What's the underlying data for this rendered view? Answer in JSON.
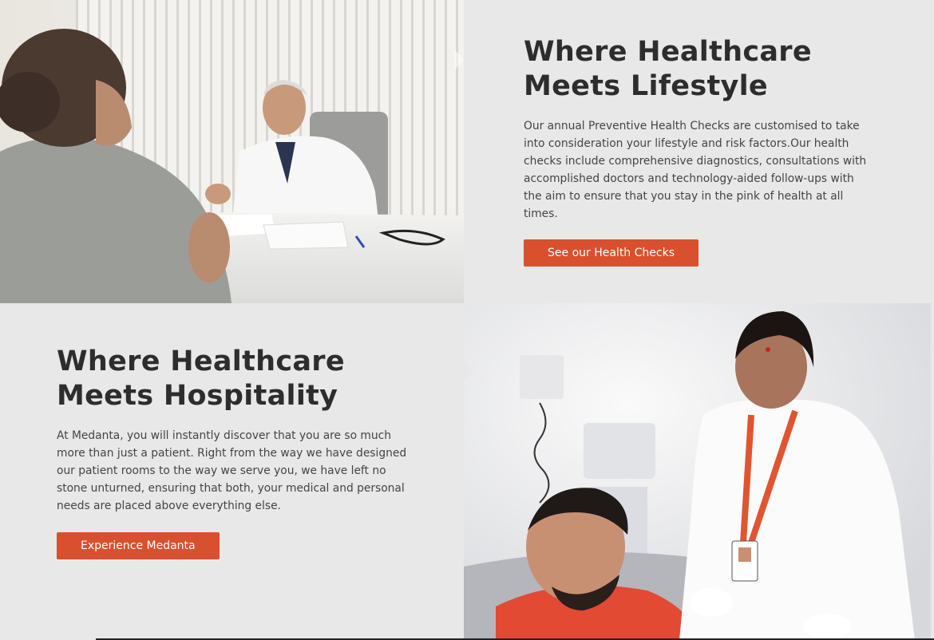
{
  "section_lifestyle": {
    "title_line1": "Where Healthcare",
    "title_line2": "Meets Lifestyle",
    "description": "Our annual Preventive Health Checks are customised to take into consideration your lifestyle and risk factors.Our health checks include comprehensive diagnostics, consultations with accomplished doctors and technology-aided follow-ups with the aim to ensure that you stay in the pink of health at all times.",
    "button_label": "See our Health Checks"
  },
  "section_hospitality": {
    "title_line1": "Where Healthcare",
    "title_line2": "Meets Hospitality",
    "description": "At Medanta, you will instantly discover that you are so much more than just a patient. Right from the way we have designed our patient rooms to the way we serve you, we have left no stone unturned, ensuring that both, your medical and personal needs are placed above everything else.",
    "button_label": "Experience Medanta"
  },
  "colors": {
    "accent": "#d9502f",
    "background": "#e8e8e8",
    "heading": "#2d2d2d",
    "body": "#444444"
  }
}
